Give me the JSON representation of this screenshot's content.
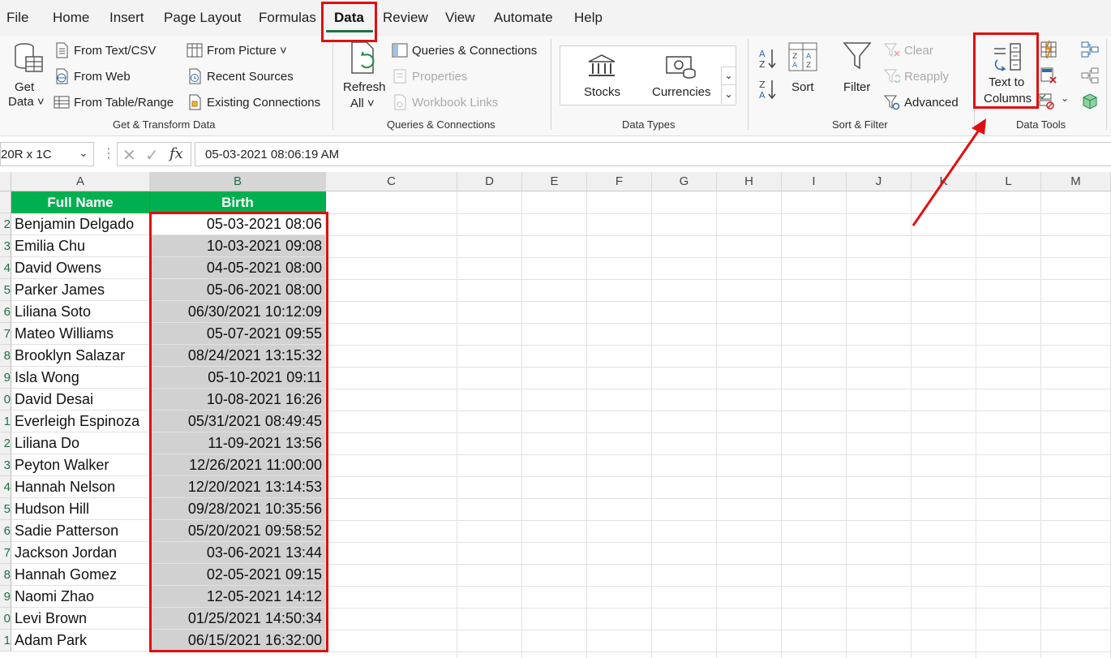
{
  "menu": {
    "tabs": [
      "File",
      "Home",
      "Insert",
      "Page Layout",
      "Formulas",
      "Data",
      "Review",
      "View",
      "Automate",
      "Help"
    ],
    "active": "Data"
  },
  "ribbon": {
    "get_transform": {
      "get_data_line1": "Get",
      "get_data_line2": "Data ˅",
      "from_text_csv": "From Text/CSV",
      "from_web": "From Web",
      "from_table_range": "From Table/Range",
      "from_picture": "From Picture ˅",
      "recent_sources": "Recent Sources",
      "existing_connections": "Existing Connections",
      "label": "Get & Transform Data"
    },
    "queries": {
      "refresh_line1": "Refresh",
      "refresh_line2": "All ˅",
      "queries_connections": "Queries & Connections",
      "properties": "Properties",
      "workbook_links": "Workbook Links",
      "label": "Queries & Connections"
    },
    "data_types": {
      "stocks": "Stocks",
      "currencies": "Currencies",
      "label": "Data Types"
    },
    "sort_filter": {
      "sort": "Sort",
      "filter": "Filter",
      "clear": "Clear",
      "reapply": "Reapply",
      "advanced": "Advanced",
      "label": "Sort & Filter"
    },
    "data_tools": {
      "text_to_line1": "Text to",
      "text_to_line2": "Columns",
      "label": "Data Tools"
    }
  },
  "formula_bar": {
    "name_box": "20R x 1C",
    "formula": "05-03-2021  08:06:19 AM"
  },
  "columns": [
    "A",
    "B",
    "C",
    "D",
    "E",
    "F",
    "G",
    "H",
    "I",
    "J",
    "K",
    "L",
    "M"
  ],
  "table": {
    "headers": [
      "Full Name",
      "Birth"
    ],
    "rows": [
      {
        "n": "2",
        "name": "Benjamin Delgado",
        "birth": "05-03-2021 08:06"
      },
      {
        "n": "3",
        "name": "Emilia Chu",
        "birth": "10-03-2021 09:08"
      },
      {
        "n": "4",
        "name": "David Owens",
        "birth": "04-05-2021 08:00"
      },
      {
        "n": "5",
        "name": "Parker James",
        "birth": "05-06-2021 08:00"
      },
      {
        "n": "6",
        "name": "Liliana Soto",
        "birth": "06/30/2021 10:12:09"
      },
      {
        "n": "7",
        "name": "Mateo Williams",
        "birth": "05-07-2021 09:55"
      },
      {
        "n": "8",
        "name": "Brooklyn Salazar",
        "birth": "08/24/2021 13:15:32"
      },
      {
        "n": "9",
        "name": "Isla Wong",
        "birth": "05-10-2021 09:11"
      },
      {
        "n": "0",
        "name": "David Desai",
        "birth": "10-08-2021 16:26"
      },
      {
        "n": "1",
        "name": "Everleigh Espinoza",
        "birth": "05/31/2021 08:49:45"
      },
      {
        "n": "2",
        "name": "Liliana Do",
        "birth": "11-09-2021 13:56"
      },
      {
        "n": "3",
        "name": "Peyton Walker",
        "birth": "12/26/2021 11:00:00"
      },
      {
        "n": "4",
        "name": "Hannah Nelson",
        "birth": "12/20/2021 13:14:53"
      },
      {
        "n": "5",
        "name": "Hudson Hill",
        "birth": "09/28/2021 10:35:56"
      },
      {
        "n": "6",
        "name": "Sadie Patterson",
        "birth": "05/20/2021 09:58:52"
      },
      {
        "n": "7",
        "name": "Jackson Jordan",
        "birth": "03-06-2021 13:44"
      },
      {
        "n": "8",
        "name": "Hannah Gomez",
        "birth": "02-05-2021 09:15"
      },
      {
        "n": "9",
        "name": "Naomi Zhao",
        "birth": "12-05-2021 14:12"
      },
      {
        "n": "0",
        "name": "Levi Brown",
        "birth": "01/25/2021 14:50:34"
      },
      {
        "n": "1",
        "name": "Adam Park",
        "birth": "06/15/2021 16:32:00"
      }
    ]
  },
  "colors": {
    "header_green": "#00b050",
    "highlight_red": "#e01010",
    "excel_green": "#1e7145"
  }
}
